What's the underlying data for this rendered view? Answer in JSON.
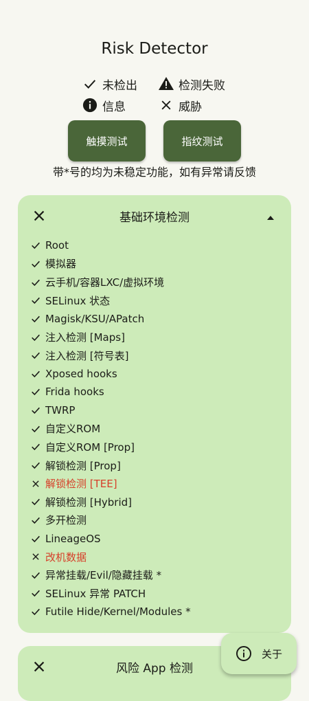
{
  "app": {
    "title": "Risk Detector"
  },
  "legend": {
    "not_detected": "未检出",
    "detect_failed": "检测失败",
    "info": "信息",
    "threat": "威胁"
  },
  "buttons": {
    "touch_test": "触摸测试",
    "fingerprint_test": "指纹测试"
  },
  "note": "带*号的均为未稳定功能，如有异常请反馈",
  "basic_section": {
    "title": "基础环境检测",
    "status_icon": "close-icon",
    "expanded": true,
    "items": [
      {
        "label": "Root",
        "status": "pass"
      },
      {
        "label": "模拟器",
        "status": "pass"
      },
      {
        "label": "云手机/容器LXC/虚拟环境",
        "status": "pass"
      },
      {
        "label": "SELinux 状态",
        "status": "pass"
      },
      {
        "label": "Magisk/KSU/APatch",
        "status": "pass"
      },
      {
        "label": "注入检测 [Maps]",
        "status": "pass"
      },
      {
        "label": "注入检测 [符号表]",
        "status": "pass"
      },
      {
        "label": "Xposed hooks",
        "status": "pass"
      },
      {
        "label": "Frida hooks",
        "status": "pass"
      },
      {
        "label": "TWRP",
        "status": "pass"
      },
      {
        "label": "自定义ROM",
        "status": "pass"
      },
      {
        "label": "自定义ROM [Prop]",
        "status": "pass"
      },
      {
        "label": "解锁检测 [Prop]",
        "status": "pass"
      },
      {
        "label": "解锁检测 [TEE]",
        "status": "threat"
      },
      {
        "label": "解锁检测 [Hybrid]",
        "status": "pass"
      },
      {
        "label": "多开检测",
        "status": "pass"
      },
      {
        "label": "LineageOS",
        "status": "pass"
      },
      {
        "label": "改机数据",
        "status": "threat"
      },
      {
        "label": "异常挂载/Evil/隐藏挂载 *",
        "status": "pass"
      },
      {
        "label": "SELinux 异常 PATCH",
        "status": "pass"
      },
      {
        "label": "Futile Hide/Kernel/Modules *",
        "status": "pass"
      }
    ]
  },
  "app_section": {
    "title": "风险 App 检测",
    "status_icon": "close-icon"
  },
  "fab": {
    "label": "关于",
    "icon": "info-icon"
  },
  "colors": {
    "background": "#f7f7f1",
    "card": "#cdebb9",
    "button": "#4a6639",
    "threat_text": "#d6402a",
    "text": "#1b1c18"
  }
}
